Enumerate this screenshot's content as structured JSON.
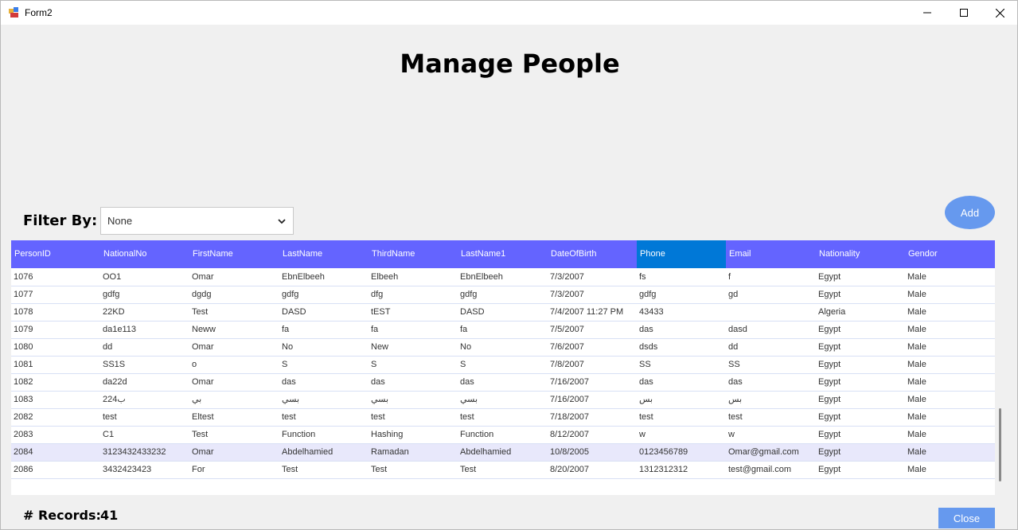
{
  "window": {
    "title": "Form2"
  },
  "page": {
    "heading": "Manage People"
  },
  "filter": {
    "label": "Filter By:",
    "selected": "None"
  },
  "buttons": {
    "add": "Add",
    "close": "Close"
  },
  "grid": {
    "columns": [
      "PersonID",
      "NationalNo",
      "FirstName",
      "LastName",
      "ThirdName",
      "LastName1",
      "DateOfBirth",
      "Phone",
      "Email",
      "Nationality",
      "Gendor"
    ],
    "highlighted_column": "Phone",
    "selected_row": "2084",
    "rows": [
      [
        "1076",
        "OO1",
        "Omar",
        "EbnElbeeh",
        "Elbeeh",
        "EbnElbeeh",
        "7/3/2007",
        "fs",
        "f",
        "Egypt",
        "Male"
      ],
      [
        "1077",
        "gdfg",
        "dgdg",
        "gdfg",
        "dfg",
        "gdfg",
        "7/3/2007",
        "gdfg",
        "gd",
        "Egypt",
        "Male"
      ],
      [
        "1078",
        "22KD",
        "Test",
        "DASD",
        "tEST",
        "DASD",
        "7/4/2007 11:27 PM",
        "43433",
        "",
        "Algeria",
        "Male"
      ],
      [
        "1079",
        "da1e113",
        "Neww",
        "fa",
        "fa",
        "fa",
        "7/5/2007",
        "das",
        "dasd",
        "Egypt",
        "Male"
      ],
      [
        "1080",
        "dd",
        "Omar",
        "No",
        "New",
        "No",
        "7/6/2007",
        "dsds",
        "dd",
        "Egypt",
        "Male"
      ],
      [
        "1081",
        "SS1S",
        "o",
        "S",
        "S",
        "S",
        "7/8/2007",
        "SS",
        "SS",
        "Egypt",
        "Male"
      ],
      [
        "1082",
        "da22d",
        "Omar",
        "das",
        "das",
        "das",
        "7/16/2007",
        "das",
        "das",
        "Egypt",
        "Male"
      ],
      [
        "1083",
        "ب224",
        "بي",
        "بسي",
        "بسي",
        "بسي",
        "7/16/2007",
        "بس",
        "بس",
        "Egypt",
        "Male"
      ],
      [
        "2082",
        "test",
        "Eltest",
        "test",
        "test",
        "test",
        "7/18/2007",
        "test",
        "test",
        "Egypt",
        "Male"
      ],
      [
        "2083",
        "C1",
        "Test",
        "Function",
        "Hashing",
        "Function",
        "8/12/2007",
        "w",
        "w",
        "Egypt",
        "Male"
      ],
      [
        "2084",
        "3123432433232",
        "Omar",
        "Abdelhamied",
        "Ramadan",
        "Abdelhamied",
        "10/8/2005",
        "0123456789",
        "Omar@gmail.com",
        "Egypt",
        "Male"
      ],
      [
        "2086",
        "3432423423",
        "For",
        "Test",
        "Test",
        "Test",
        "8/20/2007",
        "1312312312",
        "test@gmail.com",
        "Egypt",
        "Male"
      ]
    ]
  },
  "records": {
    "label": "# Records:",
    "count": "41"
  },
  "colors": {
    "header_bg": "#6464ff",
    "highlight_col": "#0078d7",
    "button_bg": "#6699ee",
    "selected_row": "#e8e8fb"
  },
  "icons": {
    "app": "form-app-icon",
    "minimize": "minimize-icon",
    "maximize": "maximize-icon",
    "close": "close-icon",
    "dropdown": "chevron-down-icon"
  }
}
